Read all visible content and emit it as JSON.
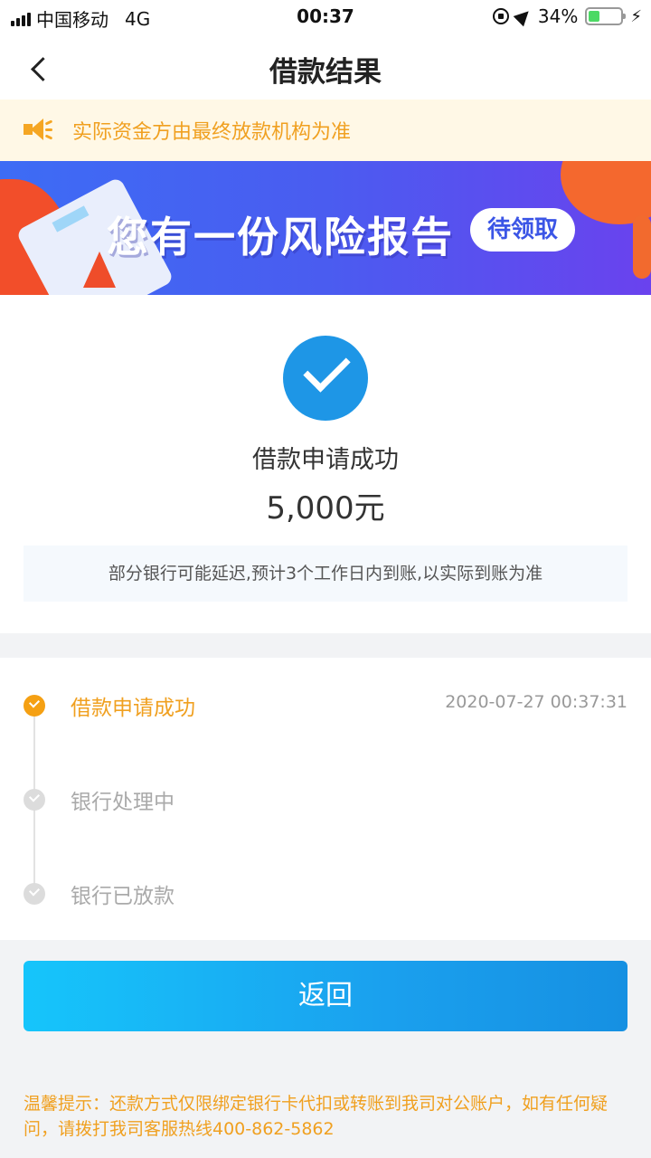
{
  "status_bar": {
    "carrier": "中国移动",
    "network": "4G",
    "time": "00:37",
    "battery": "34%",
    "battery_level": 0.34
  },
  "nav": {
    "title": "借款结果"
  },
  "notice": {
    "text": "实际资金方由最终放款机构为准"
  },
  "banner": {
    "title": "您有一份风险报告",
    "badge": "待领取"
  },
  "result": {
    "title": "借款申请成功",
    "amount": "5,000元",
    "note": "部分银行可能延迟,预计3个工作日内到账,以实际到账为准"
  },
  "timeline": {
    "steps": [
      {
        "label": "借款申请成功",
        "time": "2020-07-27 00:37:31",
        "status": "done"
      },
      {
        "label": "银行处理中",
        "time": "",
        "status": "pending"
      },
      {
        "label": "银行已放款",
        "time": "",
        "status": "pending"
      }
    ]
  },
  "actions": {
    "return_label": "返回"
  },
  "tip": {
    "text": "温馨提示：还款方式仅限绑定银行卡代扣或转账到我司对公账户，如有任何疑问，请拨打我司客服热线400-862-5862"
  },
  "colors": {
    "accent_orange": "#f0a020",
    "primary_blue": "#1e96e6",
    "notice_bg": "#fff8e6"
  }
}
